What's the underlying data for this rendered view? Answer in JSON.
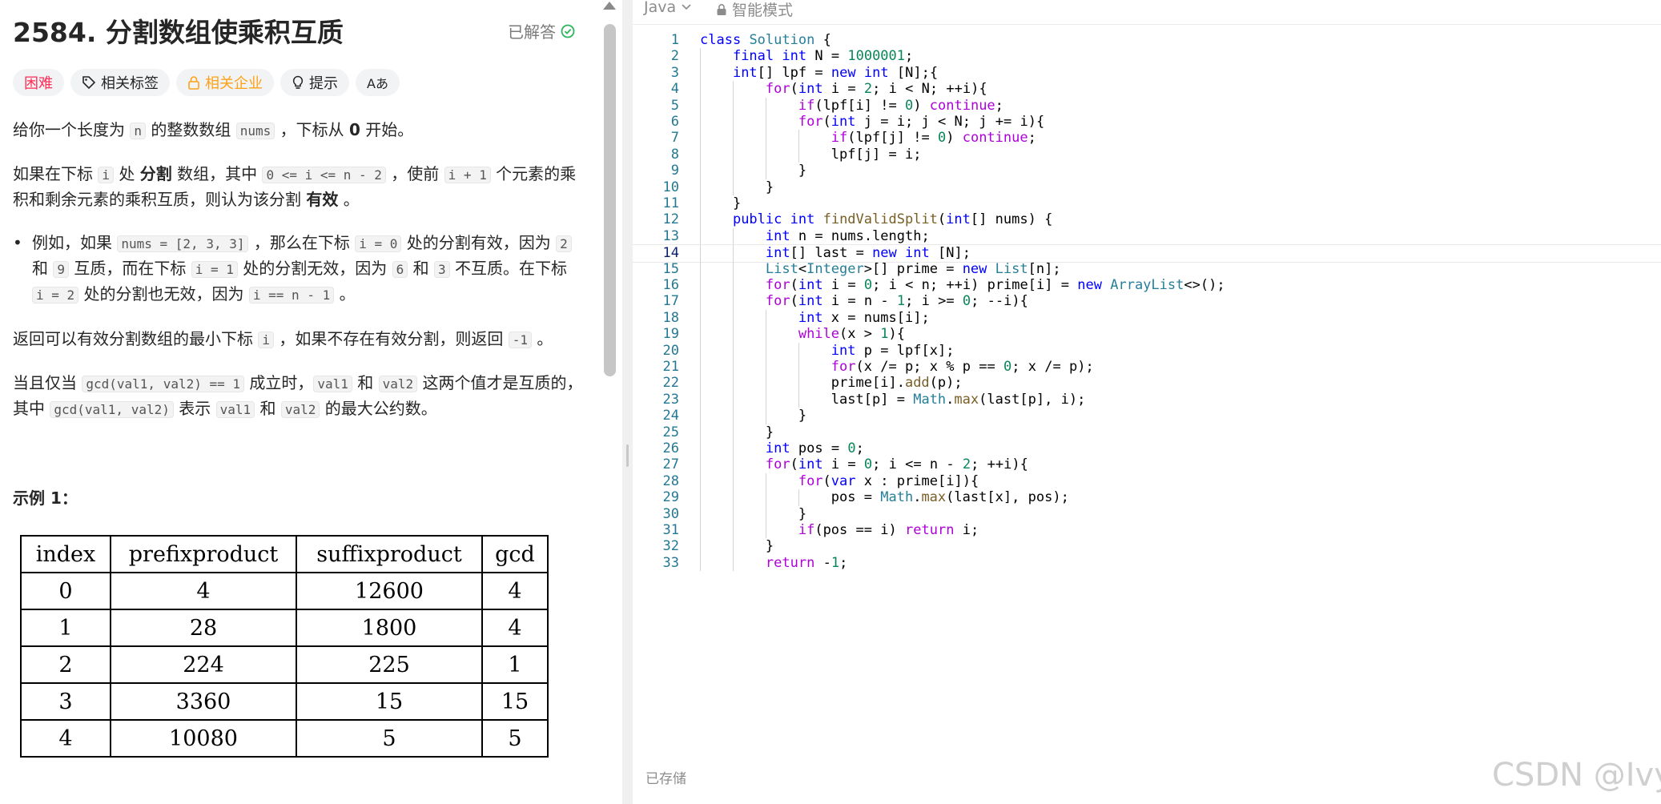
{
  "problem": {
    "title": "2584. 分割数组使乘积互质",
    "solved_label": "已解答",
    "tags": [
      "困难",
      "相关标签",
      "相关企业",
      "提示",
      "Aあ"
    ],
    "p1": [
      "给你一个长度为 ",
      "n",
      " 的整数数组 ",
      "nums",
      " ，下标从 ",
      "0",
      " 开始。"
    ],
    "p2": [
      "如果在下标 ",
      "i",
      " 处 ",
      "分割",
      " 数组，其中 ",
      "0 <= i <= n - 2",
      " ，使前 ",
      "i + 1",
      " 个元素的乘积和剩余元素的乘积互质，则认为该分割 ",
      "有效",
      " 。"
    ],
    "bullet": [
      "例如，如果 ",
      "nums = [2, 3, 3]",
      " ，那么在下标 ",
      "i = 0",
      " 处的分割有效，因为 ",
      "2",
      " 和 ",
      "9",
      " 互质，而在下标 ",
      "i = 1",
      " 处的分割无效，因为 ",
      "6",
      " 和 ",
      "3",
      " 不互质。在下标 ",
      "i = 2",
      " 处的分割也无效，因为 ",
      "i == n - 1",
      " 。"
    ],
    "p3": [
      "返回可以有效分割数组的最小下标 ",
      "i",
      " ，如果不存在有效分割，则返回 ",
      "-1",
      " 。"
    ],
    "p4": [
      "当且仅当 ",
      "gcd(val1, val2) == 1",
      " 成立时，",
      "val1",
      " 和 ",
      "val2",
      " 这两个值才是互质的，其中 ",
      "gcd(val1, val2)",
      " 表示 ",
      "val1",
      " 和 ",
      "val2",
      " 的最大公约数。"
    ],
    "example_title": "示例 1：",
    "table": {
      "headers": [
        "index",
        "prefixproduct",
        "suffixproduct",
        "gcd"
      ],
      "rows": [
        [
          "0",
          "4",
          "12600",
          "4"
        ],
        [
          "1",
          "28",
          "1800",
          "4"
        ],
        [
          "2",
          "224",
          "225",
          "1"
        ],
        [
          "3",
          "3360",
          "15",
          "15"
        ],
        [
          "4",
          "10080",
          "5",
          "5"
        ]
      ]
    }
  },
  "editor": {
    "language": "Java",
    "mode_label": "智能模式",
    "saved_label": "已存储",
    "active_line": 14,
    "lines": [
      "class Solution {",
      "    final int N = 1000001;",
      "    int[] lpf = new int [N];{",
      "        for(int i = 2; i < N; ++i){",
      "            if(lpf[i] != 0) continue;",
      "            for(int j = i; j < N; j += i){",
      "                if(lpf[j] != 0) continue;",
      "                lpf[j] = i;",
      "            }",
      "        }",
      "    }",
      "    public int findValidSplit(int[] nums) {",
      "        int n = nums.length;",
      "        int[] last = new int [N];",
      "        List<Integer>[] prime = new List[n];",
      "        for(int i = 0; i < n; ++i) prime[i] = new ArrayList<>();",
      "        for(int i = n - 1; i >= 0; --i){",
      "            int x = nums[i];",
      "            while(x > 1){",
      "                int p = lpf[x];",
      "                for(x /= p; x % p == 0; x /= p);",
      "                prime[i].add(p);",
      "                last[p] = Math.max(last[p], i);",
      "            }",
      "        }",
      "        int pos = 0;",
      "        for(int i = 0; i <= n - 2; ++i){",
      "            for(var x : prime[i]){",
      "                pos = Math.max(last[x], pos);",
      "            }",
      "            if(pos == i) return i;",
      "        }",
      "        return -1;"
    ]
  },
  "watermark": "CSDN @Ivy-",
  "colors": {
    "hard": "#ff2d55",
    "company": "#ffa116",
    "solved_check": "#2db55d",
    "keyword": "#0000ff",
    "control": "#af00db",
    "number": "#098658",
    "type": "#267f99",
    "function": "#795e26"
  }
}
